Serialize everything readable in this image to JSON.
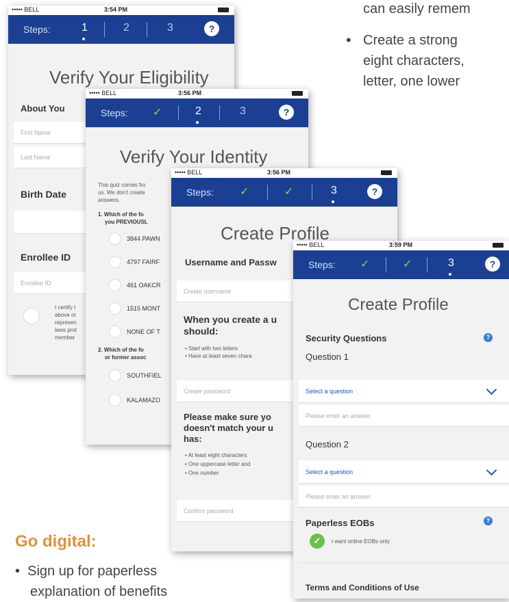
{
  "top_text": {
    "continued": "can easily remem",
    "bullet": "•",
    "lines": [
      "Create a strong",
      "eight characters,",
      "letter, one lower"
    ]
  },
  "common": {
    "steps_label": "Steps:",
    "step1": "1",
    "step2": "2",
    "step3": "3",
    "check": "✓",
    "help": "?",
    "carrier": "••••• BELL"
  },
  "phone1": {
    "time": "3:54 PM",
    "title": "Verify Your Eligibility",
    "about_you": "About You",
    "first_name_placeholder": "First Name",
    "last_name_placeholder": "Last Name",
    "birth_date": "Birth Date",
    "enrollee_id": "Enrollee ID",
    "enrollee_id_placeholder": "Enrollee ID",
    "certify_lines": [
      "I certify t",
      "above or",
      "represen",
      "laws prot",
      "member"
    ]
  },
  "phone2": {
    "time": "3:56 PM",
    "title": "Verify Your Identity",
    "intro_lines": [
      "This quiz comes fro",
      "us. We don't create",
      "answers."
    ],
    "q1_lines": [
      "1. Which of the fo",
      "you PREVIOUSL"
    ],
    "q1_options": [
      "3844 PAWN",
      "4797 FAIRF",
      "461 OAKCR",
      "1515 MONT",
      "NONE OF T"
    ],
    "q2_lines": [
      "2. Which of the fo",
      "or former assoc"
    ],
    "q2_options": [
      "SOUTHFIEL",
      "KALAMAZO"
    ]
  },
  "phone3": {
    "time": "3:56 PM",
    "title": "Create Profile",
    "username_heading": "Username and Passw",
    "create_username_placeholder": "Create username",
    "when_lines": [
      "When you create a u",
      "should:"
    ],
    "rules": [
      "Start with two letters",
      "Have at least seven chara"
    ],
    "create_password_placeholder": "Create password",
    "please_lines": [
      "Please make sure yo",
      "doesn't match your u",
      "has:"
    ],
    "pw_rules": [
      "At least eight characters",
      "One uppercase letter and",
      "One number"
    ],
    "confirm_password_placeholder": "Confirm password"
  },
  "phone4": {
    "time": "3:59 PM",
    "title": "Create Profile",
    "security_questions": "Security Questions",
    "question1": "Question 1",
    "select_question": "Select a question",
    "answer_placeholder": "Please enter an answer.",
    "question2": "Question 2",
    "paperless": "Paperless EOBs",
    "online_only": "I want online EOBs only",
    "terms": "Terms and Conditions of Use"
  },
  "bottom": {
    "go_digital": "Go digital:",
    "bullet": "•",
    "lines": [
      "Sign up for paperless",
      "explanation of benefits"
    ]
  }
}
